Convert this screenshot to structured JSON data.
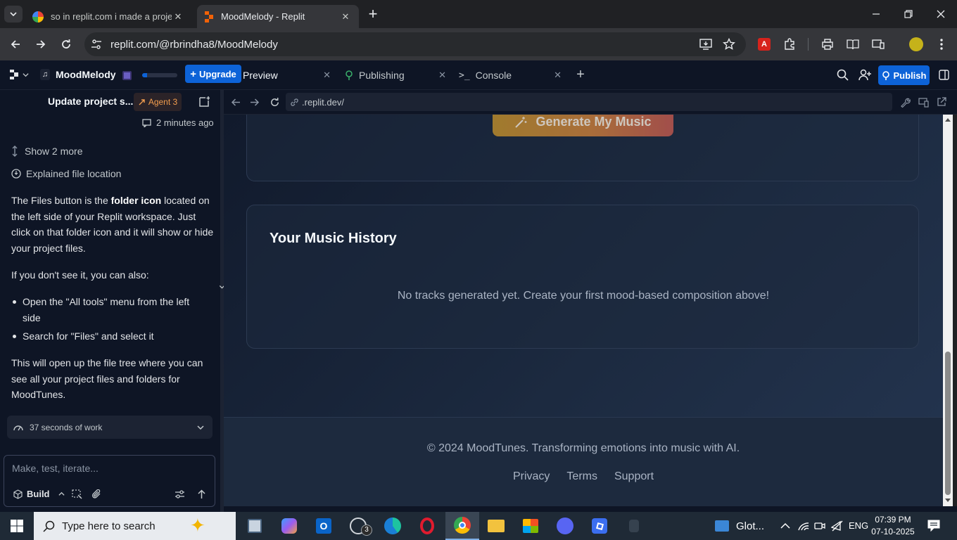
{
  "browser": {
    "tabs": [
      {
        "title": "so in replit.com i made a project",
        "favicon": "google-icon"
      },
      {
        "title": "MoodMelody - Replit",
        "favicon": "replit-icon"
      }
    ],
    "url": "replit.com/@rbrindha8/MoodMelody"
  },
  "replit_header": {
    "project_name": "MoodMelody",
    "upgrade_label": "Upgrade",
    "tabs": [
      {
        "label": "Preview"
      },
      {
        "label": "Publishing"
      },
      {
        "label": "Console"
      }
    ],
    "publish_label": "Publish"
  },
  "agent_panel": {
    "thread_title": "Update project s...",
    "agent_badge": "Agent 3",
    "timestamp": "2 minutes ago",
    "show_more": "Show 2 more",
    "explained": "Explained file location",
    "para1_a": "The Files button is the ",
    "para1_bold": "folder icon",
    "para1_b": " located on the left side of your Replit workspace. Just click on that folder icon and it will show or hide your project files.",
    "para2": "If you don't see it, you can also:",
    "bullets": [
      "Open the \"All tools\" menu from the left side",
      "Search for \"Files\" and select it"
    ],
    "para3": "This will open up the file tree where you can see all your project files and folders for MoodTunes.",
    "work_time": "37 seconds of work",
    "input_placeholder": "Make, test, iterate...",
    "build_label": "Build"
  },
  "preview": {
    "url": ".replit.dev/",
    "generate_button": "Generate My Music",
    "history_title": "Your Music History",
    "empty_message": "No tracks generated yet. Create your first mood-based composition above!",
    "footer_copyright": "© 2024 MoodTunes. Transforming emotions into music with AI.",
    "footer_links": [
      "Privacy",
      "Terms",
      "Support"
    ]
  },
  "taskbar": {
    "search_placeholder": "Type here to search",
    "whatsapp_badge": "3",
    "glot_label": "Glot...",
    "language": "ENG",
    "time": "07:39 PM",
    "date": "07-10-2025"
  }
}
